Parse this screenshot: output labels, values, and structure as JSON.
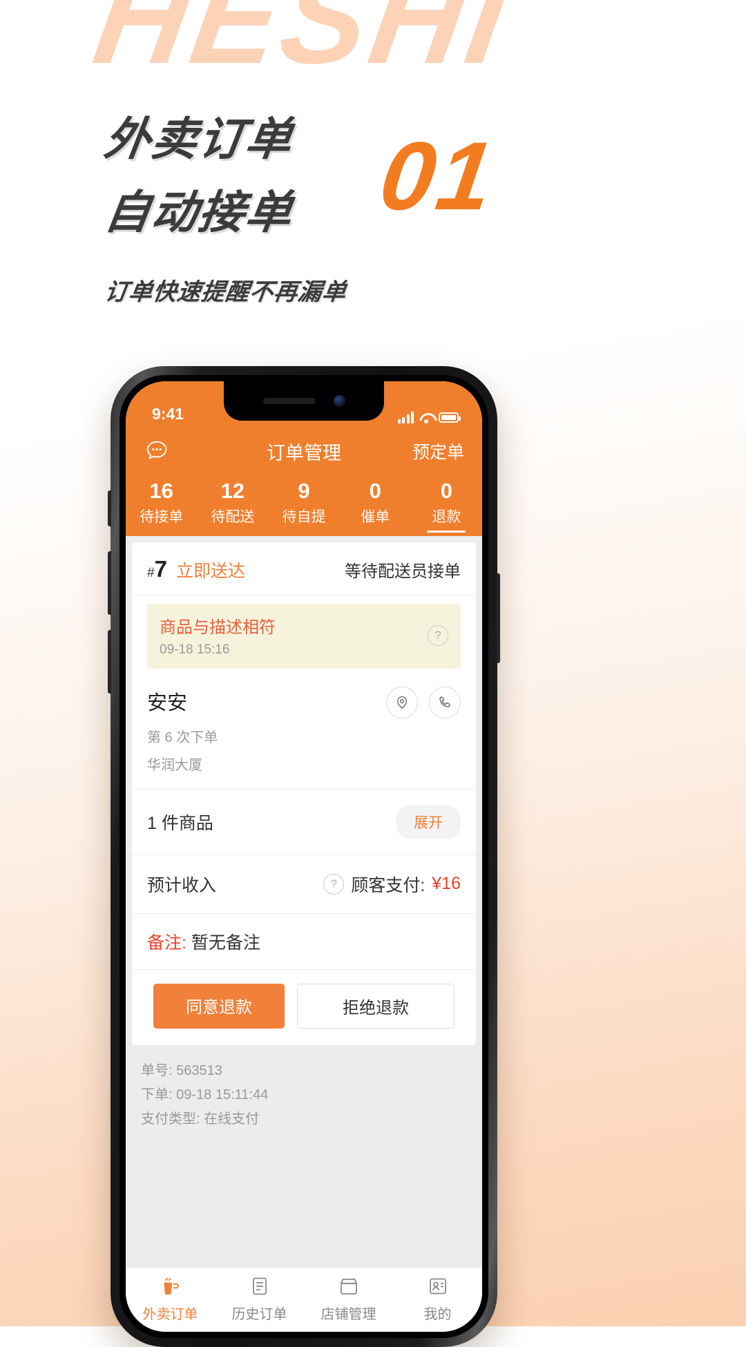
{
  "watermark": "HESHI",
  "promo": {
    "headline_1": "外卖订单",
    "headline_2": "自动接单",
    "subline": "订单快速提醒不再漏单",
    "step_number": "01",
    "accent_color": "#f47c20",
    "headline_color": "#3b3b3b"
  },
  "phone": {
    "status_bar": {
      "time": "9:41"
    },
    "app_header": {
      "chat_icon": "chat-bubble-icon",
      "title": "订单管理",
      "right_action": "预定单"
    },
    "tabs": [
      {
        "count": "16",
        "label": "待接单",
        "active": false
      },
      {
        "count": "12",
        "label": "待配送",
        "active": false
      },
      {
        "count": "9",
        "label": "待自提",
        "active": false
      },
      {
        "count": "0",
        "label": "催单",
        "active": false
      },
      {
        "count": "0",
        "label": "退款",
        "active": true
      }
    ],
    "order": {
      "hash_symbol": "#",
      "sequence": "7",
      "delivery_type": "立即送达",
      "status": "等待配送员接单",
      "notice": {
        "reason": "商品与描述相符",
        "time": "09-18 15:16",
        "help_icon": "question-mark-icon"
      },
      "customer": {
        "name": "安安",
        "order_count": "第 6 次下单",
        "address": "华润大厦",
        "location_icon": "map-pin-icon",
        "phone_icon": "phone-icon"
      },
      "goods": {
        "summary": "1 件商品",
        "expand_label": "展开"
      },
      "income": {
        "label": "预计收入",
        "help_icon": "question-mark-icon",
        "pay_label": "顾客支付:",
        "pay_amount": "¥16"
      },
      "remark": {
        "label": "备注:",
        "value": "暂无备注"
      },
      "actions": {
        "approve": "同意退款",
        "reject": "拒绝退款"
      },
      "meta": [
        "单号: 563513",
        "下单: 09-18 15:11:44",
        "支付类型: 在线支付"
      ]
    },
    "bottom_nav": [
      {
        "label": "外卖订单",
        "icon": "takeout-cup-icon",
        "active": true
      },
      {
        "label": "历史订单",
        "icon": "history-doc-icon",
        "active": false
      },
      {
        "label": "店铺管理",
        "icon": "shop-icon",
        "active": false
      },
      {
        "label": "我的",
        "icon": "user-card-icon",
        "active": false
      }
    ]
  }
}
